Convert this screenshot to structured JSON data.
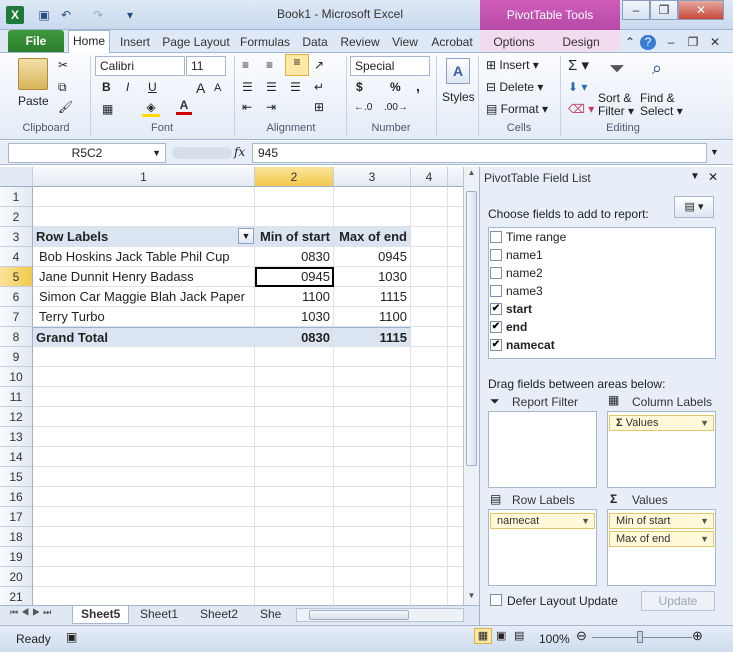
{
  "window": {
    "title": "Book1 - Microsoft Excel",
    "contextual_header": "PivotTable Tools",
    "minimize": "–",
    "restore": "❐",
    "close": "✕"
  },
  "quick_access": {
    "save_icon": "save-icon",
    "undo_icon": "undo-icon",
    "redo_icon": "redo-icon"
  },
  "tabs": {
    "file": "File",
    "home": "Home",
    "insert": "Insert",
    "page_layout": "Page Layout",
    "formulas": "Formulas",
    "data": "Data",
    "review": "Review",
    "view": "View",
    "acrobat": "Acrobat",
    "options": "Options",
    "design": "Design"
  },
  "ribbon": {
    "clipboard": {
      "label": "Clipboard",
      "paste": "Paste"
    },
    "font": {
      "label": "Font",
      "name": "Calibri",
      "size": "11",
      "bold": "B",
      "italic": "I",
      "underline": "U",
      "grow": "A",
      "shrink": "A"
    },
    "alignment": {
      "label": "Alignment"
    },
    "number": {
      "label": "Number",
      "format": "Special",
      "currency": "$",
      "percent": "%",
      "comma": ",",
      "inc_decimal": "←.0",
      "dec_decimal": ".00→"
    },
    "styles": {
      "label": "Styles"
    },
    "cells": {
      "label": "Cells",
      "insert": "Insert",
      "delete": "Delete",
      "format": "Format"
    },
    "editing": {
      "label": "Editing",
      "sort": "Sort &",
      "filter": "Filter",
      "find": "Find &",
      "select": "Select"
    }
  },
  "formula_bar": {
    "name_box": "R5C2",
    "fx": "fx",
    "value": "945"
  },
  "grid": {
    "columns": [
      "1",
      "2",
      "3",
      "4"
    ],
    "rows": [
      "1",
      "2",
      "3",
      "4",
      "5",
      "6",
      "7",
      "8",
      "9",
      "10",
      "11",
      "12",
      "13",
      "14",
      "15",
      "16",
      "17",
      "18",
      "19",
      "20",
      "21"
    ],
    "pivot": {
      "headers": [
        "Row Labels",
        "Min of start",
        "Max of end"
      ],
      "rows": [
        [
          "Bob Hoskins Jack Table Phil Cup",
          "0830",
          "0945"
        ],
        [
          "Jane Dunnit Henry Badass",
          "0945",
          "1030"
        ],
        [
          "Simon Car Maggie Blah Jack Paper",
          "1100",
          "1115"
        ],
        [
          "Terry Turbo",
          "1030",
          "1100"
        ]
      ],
      "grand_total": [
        "Grand Total",
        "0830",
        "1115"
      ]
    }
  },
  "sheets": [
    "Sheet5",
    "Sheet1",
    "Sheet2",
    "She"
  ],
  "status": {
    "ready": "Ready",
    "zoom": "100%"
  },
  "pivot_pane": {
    "title": "PivotTable Field List",
    "choose_label": "Choose fields to add to report:",
    "fields": [
      {
        "name": "Time range",
        "checked": false
      },
      {
        "name": "name1",
        "checked": false
      },
      {
        "name": "name2",
        "checked": false
      },
      {
        "name": "name3",
        "checked": false
      },
      {
        "name": "start",
        "checked": true
      },
      {
        "name": "end",
        "checked": true
      },
      {
        "name": "namecat",
        "checked": true
      }
    ],
    "drag_label": "Drag fields between areas below:",
    "report_filter": "Report Filter",
    "column_labels": "Column Labels",
    "row_labels": "Row Labels",
    "values": "Values",
    "column_values_chip": "Values",
    "row_chip": "namecat",
    "value_chips": [
      "Min of start",
      "Max of end"
    ],
    "defer": "Defer Layout Update",
    "update": "Update"
  }
}
